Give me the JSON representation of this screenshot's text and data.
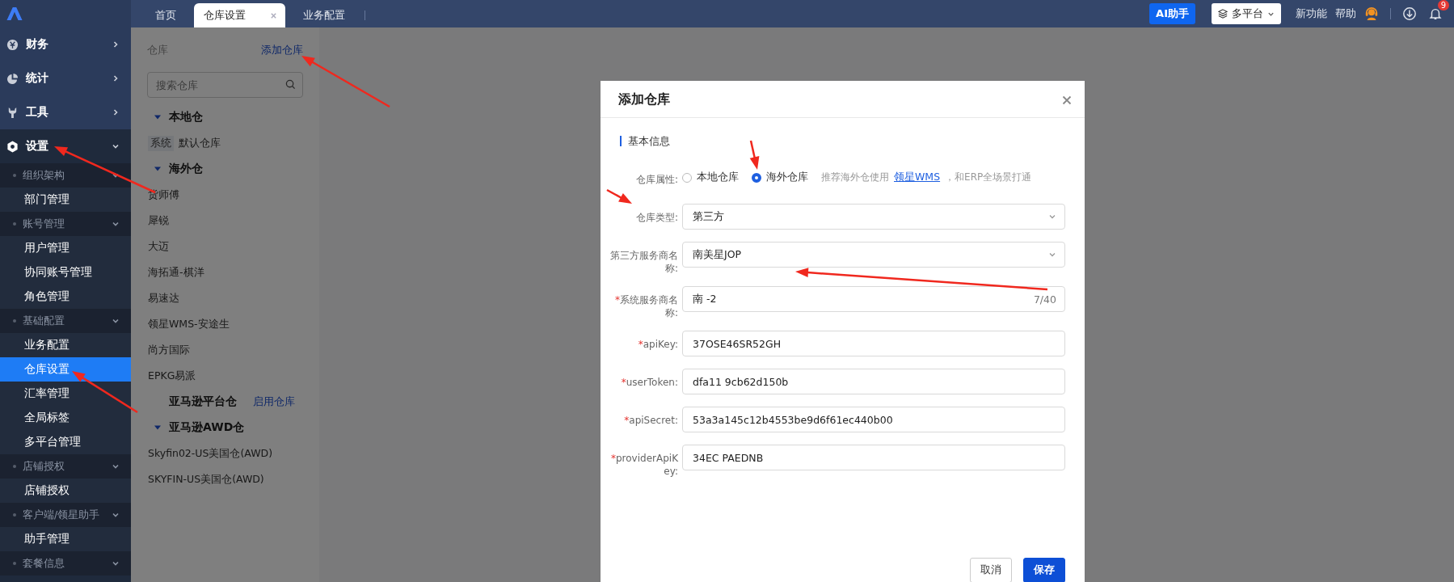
{
  "nav": [
    {
      "label": "财务",
      "expanded": false
    },
    {
      "label": "统计",
      "expanded": false
    },
    {
      "label": "工具",
      "expanded": false
    },
    {
      "label": "设置",
      "expanded": true,
      "groups": [
        {
          "label": "组织架构",
          "expanded": true,
          "items": [
            {
              "label": "部门管理",
              "selected": false
            }
          ]
        },
        {
          "label": "账号管理",
          "expanded": true,
          "items": [
            {
              "label": "用户管理",
              "selected": false
            },
            {
              "label": "协同账号管理",
              "selected": false
            },
            {
              "label": "角色管理",
              "selected": false
            }
          ]
        },
        {
          "label": "基础配置",
          "expanded": true,
          "items": [
            {
              "label": "业务配置",
              "selected": false
            },
            {
              "label": "仓库设置",
              "selected": true
            },
            {
              "label": "汇率管理",
              "selected": false
            },
            {
              "label": "全局标签",
              "selected": false
            },
            {
              "label": "多平台管理",
              "selected": false
            }
          ]
        },
        {
          "label": "店铺授权",
          "expanded": true,
          "items": [
            {
              "label": "店铺授权",
              "selected": false
            }
          ]
        },
        {
          "label": "客户端/领星助手",
          "expanded": true,
          "items": [
            {
              "label": "助手管理",
              "selected": false
            }
          ]
        },
        {
          "label": "套餐信息",
          "expanded": true
        }
      ]
    }
  ],
  "tabs": [
    {
      "label": "首页",
      "selected": false
    },
    {
      "label": "仓库设置",
      "selected": true
    },
    {
      "label": "业务配置",
      "selected": false
    }
  ],
  "topbar": {
    "ai_button": "AI助手",
    "platform_select": "多平台",
    "links": [
      "新功能",
      "帮助"
    ],
    "notification_count": "9"
  },
  "warehouse_panel": {
    "title": "仓库",
    "add_link": "添加仓库",
    "search": {
      "placeholder": "搜索仓库"
    },
    "groups": [
      {
        "label": "本地仓",
        "expanded": true,
        "children": [
          {
            "label": "默认仓库",
            "tag": "系统"
          }
        ]
      },
      {
        "label": "海外仓",
        "expanded": true,
        "children": [
          {
            "label": "货师傅"
          },
          {
            "label": "犀锐"
          },
          {
            "label": "大迈"
          },
          {
            "label": "海拓通-棋洋"
          },
          {
            "label": "易速达"
          },
          {
            "label": "领星WMS-安途生"
          },
          {
            "label": "尚方国际"
          },
          {
            "label": "EPKG易派"
          }
        ]
      },
      {
        "label": "亚马逊平台仓",
        "action": "启用仓库"
      },
      {
        "label": "亚马逊AWD仓",
        "expanded": true,
        "children": [
          {
            "label": "Skyfin02-US美国仓(AWD)"
          },
          {
            "label": "SKYFIN-US美国仓(AWD)"
          }
        ]
      }
    ]
  },
  "dialog": {
    "title": "添加仓库",
    "section": "基本信息",
    "required_mark": "*",
    "fields": [
      {
        "kind": "radio",
        "label": "仓库属性:",
        "required": false,
        "options": [
          {
            "label": "本地仓库",
            "selected": false
          },
          {
            "label": "海外仓库",
            "selected": true
          }
        ],
        "hint": "推荐海外仓使用",
        "link": "领星WMS",
        "hint_after": "，和ERP全场景打通"
      },
      {
        "kind": "select",
        "label": "仓库类型:",
        "required": false,
        "value": "第三方"
      },
      {
        "kind": "select",
        "label": "第三方服务商名称:",
        "required": false,
        "value": "南美星JOP"
      },
      {
        "kind": "input",
        "label": "系统服务商名称:",
        "required": true,
        "value": "南 -2",
        "counter": "7/40"
      },
      {
        "kind": "input",
        "label": "apiKey:",
        "required": true,
        "value": "37OSE46SR52GH"
      },
      {
        "kind": "input",
        "label": "userToken:",
        "required": true,
        "value": "dfa11 9cb62d150b"
      },
      {
        "kind": "input",
        "label": "apiSecret:",
        "required": true,
        "value": "53a3a145c12b4553be9d6f61ec440b00"
      },
      {
        "kind": "input",
        "label": "providerApiKey:",
        "required": true,
        "value": "34EC PAEDNB"
      }
    ],
    "buttons": [
      {
        "label": "取消",
        "kind": "secondary"
      },
      {
        "label": "保存",
        "kind": "primary"
      }
    ]
  }
}
